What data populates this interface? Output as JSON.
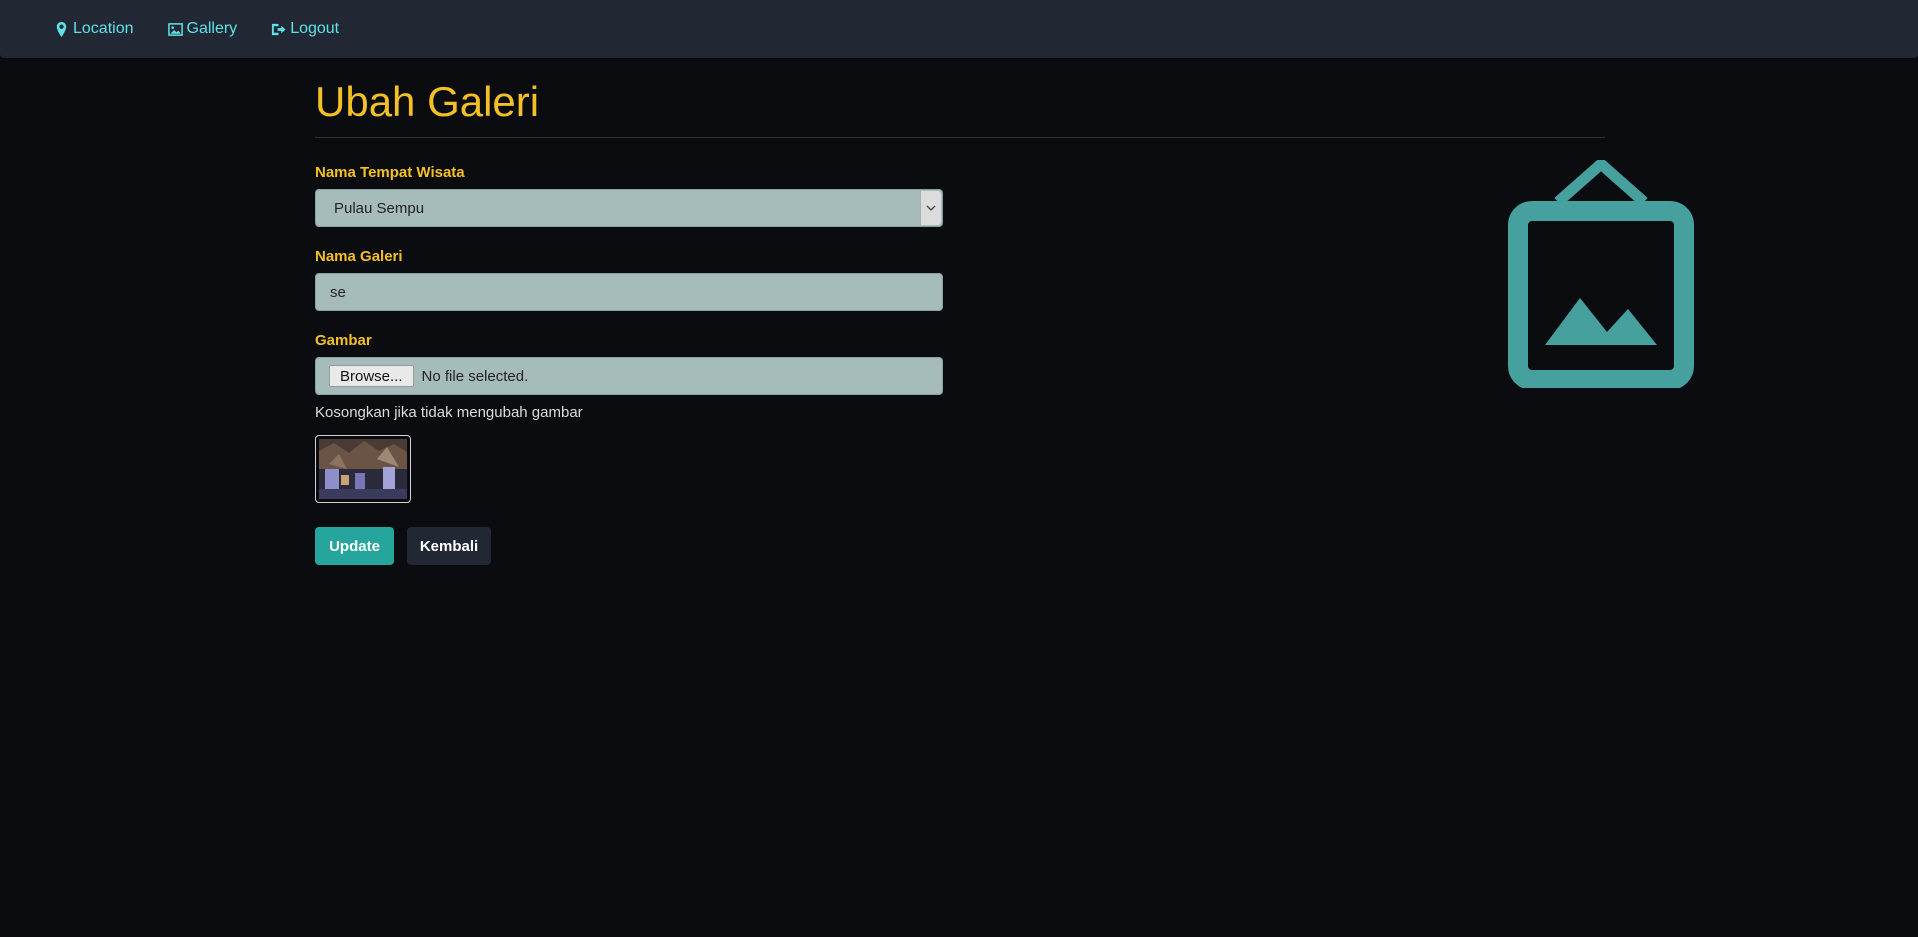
{
  "nav": {
    "items": [
      {
        "label": "Location",
        "icon": "map-marker-icon"
      },
      {
        "label": "Gallery",
        "icon": "image-icon"
      },
      {
        "label": "Logout",
        "icon": "sign-out-icon"
      }
    ]
  },
  "page": {
    "title": "Ubah Galeri"
  },
  "form": {
    "place": {
      "label": "Nama Tempat Wisata",
      "value": "Pulau Sempu"
    },
    "name": {
      "label": "Nama Galeri",
      "value": "se"
    },
    "image": {
      "label": "Gambar",
      "browse_label": "Browse...",
      "status": "No file selected.",
      "help": "Kosongkan jika tidak mengubah gambar"
    },
    "buttons": {
      "update": "Update",
      "back": "Kembali"
    }
  },
  "colors": {
    "accent": "#f3c026",
    "link": "#5ee2e8",
    "primary_button": "#25a59c",
    "illustration": "#45a09e"
  }
}
